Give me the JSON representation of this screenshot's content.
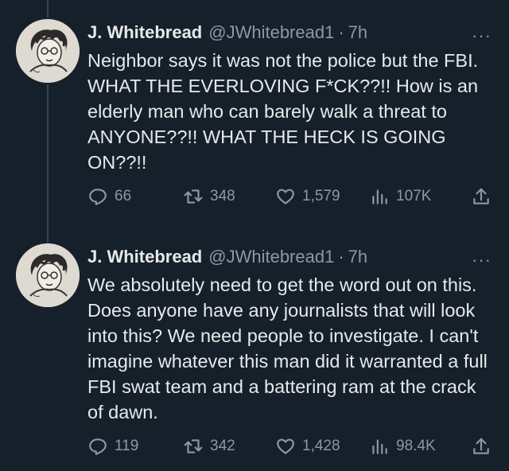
{
  "tweets": [
    {
      "name": "J. Whitebread",
      "handle": "@JWhitebread1",
      "separator": "·",
      "time": "7h",
      "text": "Neighbor says it was not the police but the FBI.  WHAT THE EVERLOVING F*CK??!! How is an elderly man who can barely walk a threat to ANYONE??!!  WHAT THE HECK IS GOING ON??!!",
      "replies": "66",
      "reposts": "348",
      "likes": "1,579",
      "views": "107K"
    },
    {
      "name": "J. Whitebread",
      "handle": "@JWhitebread1",
      "separator": "·",
      "time": "7h",
      "text": "We absolutely need to get the word out on this.  Does anyone have any journalists that will look into this?  We need people to investigate.  I can't imagine whatever this man did it warranted a full FBI swat team and a battering ram at the crack of dawn.",
      "replies": "119",
      "reposts": "342",
      "likes": "1,428",
      "views": "98.4K"
    }
  ],
  "icons": {
    "more": "more-dots-icon",
    "reply": "reply-icon",
    "repost": "repost-icon",
    "like": "heart-icon",
    "views": "views-chart-icon",
    "share": "share-icon"
  },
  "colors": {
    "background": "#15202b",
    "text": "#e7e9ea",
    "secondary": "#8b98a5",
    "thread_line": "#38444d"
  }
}
